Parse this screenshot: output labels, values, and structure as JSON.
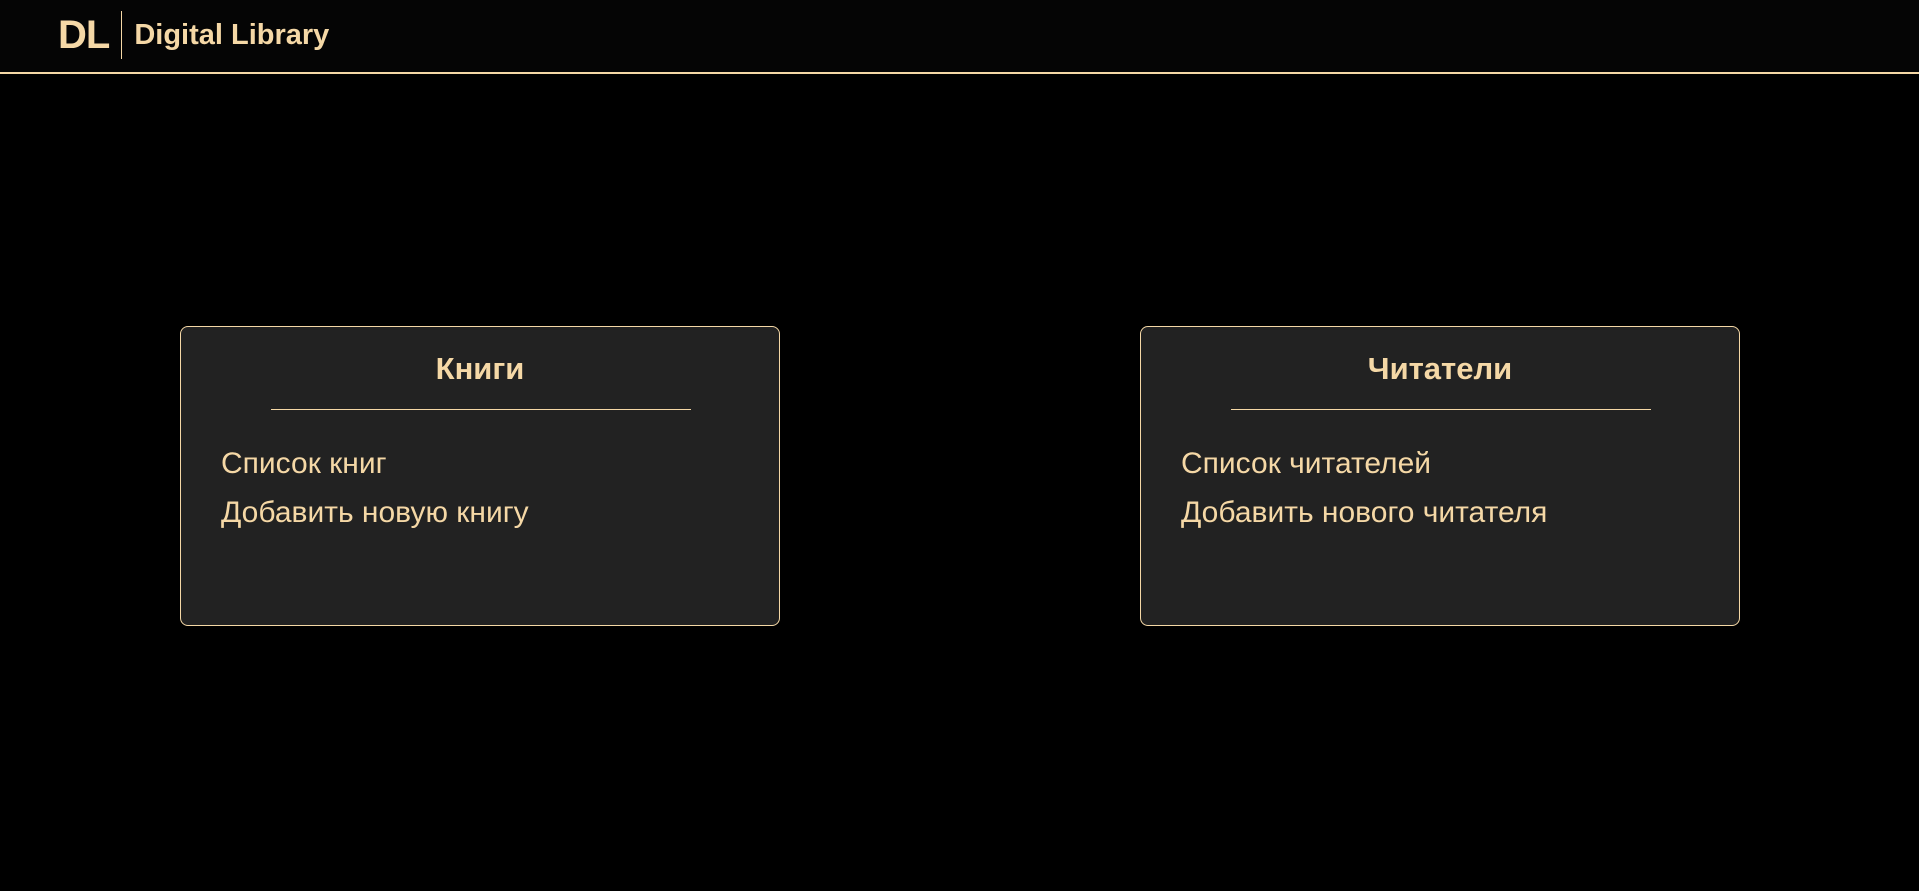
{
  "header": {
    "logo_mark": "DL",
    "app_name": "Digital Library"
  },
  "cards": {
    "books": {
      "title": "Книги",
      "links": [
        "Список книг",
        "Добавить новую книгу"
      ]
    },
    "readers": {
      "title": "Читатели",
      "links": [
        "Список читателей",
        "Добавить нового читателя"
      ]
    }
  },
  "colors": {
    "accent": "#f5d8a6",
    "background": "#000000",
    "card_background": "#222222"
  }
}
